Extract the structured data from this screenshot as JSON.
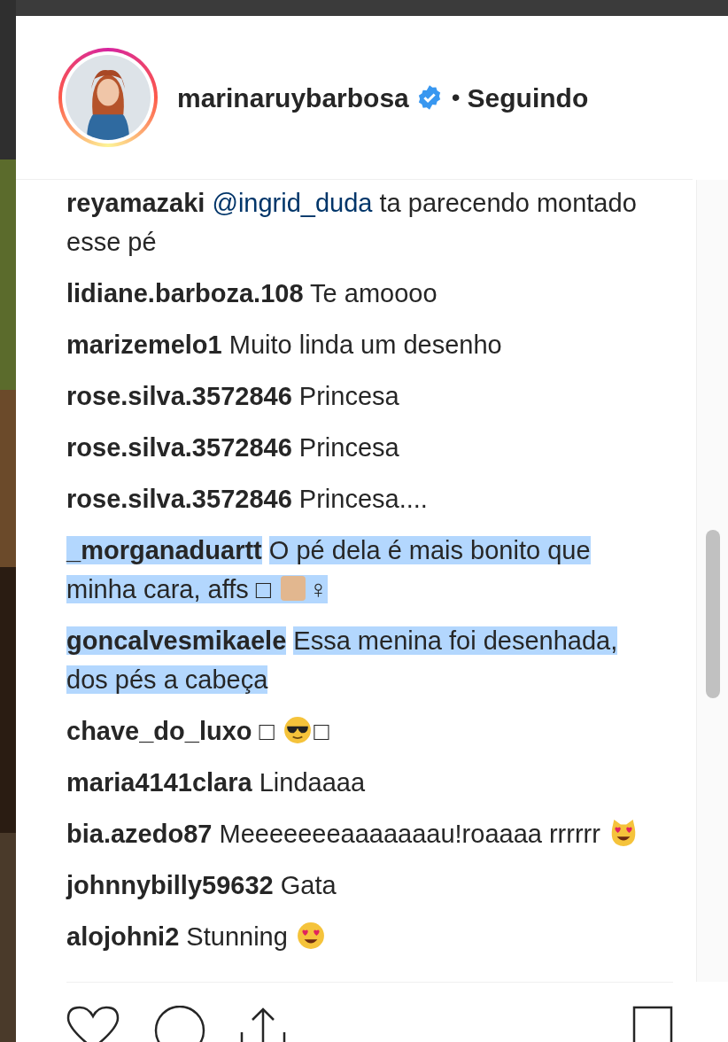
{
  "header": {
    "username": "marinaruybarbosa",
    "verified": true,
    "separator": "•",
    "follow_status": "Seguindo"
  },
  "comments": [
    {
      "user": "reyamazaki",
      "selected": false,
      "parts": [
        {
          "kind": "mention",
          "text": "@ingrid_duda"
        },
        {
          "kind": "text",
          "text": "ta parecendo montado esse pé"
        }
      ]
    },
    {
      "user": "lidiane.barboza.108",
      "selected": false,
      "parts": [
        {
          "kind": "text",
          "text": "Te amoooo"
        }
      ]
    },
    {
      "user": "marizemelo1",
      "selected": false,
      "parts": [
        {
          "kind": "text",
          "text": "Muito linda um desenho"
        }
      ]
    },
    {
      "user": "rose.silva.3572846",
      "selected": false,
      "parts": [
        {
          "kind": "text",
          "text": "Princesa"
        }
      ]
    },
    {
      "user": "rose.silva.3572846",
      "selected": false,
      "parts": [
        {
          "kind": "text",
          "text": "Princesa"
        }
      ]
    },
    {
      "user": "rose.silva.3572846",
      "selected": false,
      "parts": [
        {
          "kind": "text",
          "text": "Princesa...."
        }
      ]
    },
    {
      "user": "_morganaduartt",
      "selected": true,
      "parts": [
        {
          "kind": "text",
          "text": "O pé dela é mais bonito que minha cara, affs □"
        },
        {
          "kind": "skintone"
        },
        {
          "kind": "text",
          "text": "♀"
        }
      ]
    },
    {
      "user": "goncalvesmikaele",
      "selected": true,
      "parts": [
        {
          "kind": "text",
          "text": "Essa menina foi desenhada, dos pés a cabeça"
        }
      ]
    },
    {
      "user": "chave_do_luxo",
      "selected": false,
      "parts": [
        {
          "kind": "text",
          "text": "□"
        },
        {
          "kind": "sunglasses"
        },
        {
          "kind": "text",
          "text": "□"
        }
      ]
    },
    {
      "user": "maria4141clara",
      "selected": false,
      "parts": [
        {
          "kind": "text",
          "text": "Lindaaaa"
        }
      ]
    },
    {
      "user": "bia.azedo87",
      "selected": false,
      "parts": [
        {
          "kind": "text",
          "text": "Meeeeeeeaaaaaaau!roaaaa rrrrrr"
        },
        {
          "kind": "catheart"
        }
      ]
    },
    {
      "user": "johnnybilly59632",
      "selected": false,
      "parts": [
        {
          "kind": "text",
          "text": "Gata"
        }
      ]
    },
    {
      "user": "alojohni2",
      "selected": false,
      "parts": [
        {
          "kind": "text",
          "text": "Stunning"
        },
        {
          "kind": "hearteyes"
        }
      ]
    }
  ]
}
